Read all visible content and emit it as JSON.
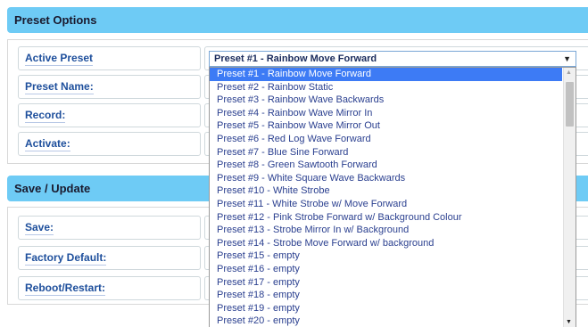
{
  "preset_options": {
    "title": "Preset Options",
    "rows": [
      {
        "label": "Active Preset"
      },
      {
        "label": "Preset Name:"
      },
      {
        "label": "Record:"
      },
      {
        "label": "Activate:"
      }
    ],
    "select": {
      "value": "Preset #1 - Rainbow Move Forward",
      "options": [
        "Preset #1 - Rainbow Move Forward",
        "Preset #2 - Rainbow Static",
        "Preset #3 - Rainbow Wave Backwards",
        "Preset #4 - Rainbow Wave Mirror In",
        "Preset #5 - Rainbow Wave Mirror Out",
        "Preset #6 - Red Log Wave Forward",
        "Preset #7 - Blue Sine Forward",
        "Preset #8 - Green Sawtooth Forward",
        "Preset #9 - White Square Wave Backwards",
        "Preset #10 - White Strobe",
        "Preset #11 - White Strobe w/ Move Forward",
        "Preset #12 - Pink Strobe Forward w/ Background Colour",
        "Preset #13 - Strobe Mirror In w/ Background",
        "Preset #14 - Strobe Move Forward w/ background",
        "Preset #15 - empty",
        "Preset #16 - empty",
        "Preset #17 - empty",
        "Preset #18 - empty",
        "Preset #19 - empty",
        "Preset #20 - empty"
      ],
      "selected_index": 0
    }
  },
  "save_update": {
    "title": "Save / Update",
    "rows": [
      {
        "label": "Save:"
      },
      {
        "label": "Factory Default:"
      },
      {
        "label": "Reboot/Restart:"
      }
    ]
  },
  "icons": {
    "dropdown_arrow": "chevron-down-icon",
    "scroll_up": "scroll-up-icon",
    "scroll_down": "scroll-down-icon"
  },
  "colors": {
    "header_bg": "#6ecbf5",
    "label_text": "#1e4f9c",
    "selected_bg": "#3d7bf5",
    "option_text": "#2a3f8f"
  }
}
